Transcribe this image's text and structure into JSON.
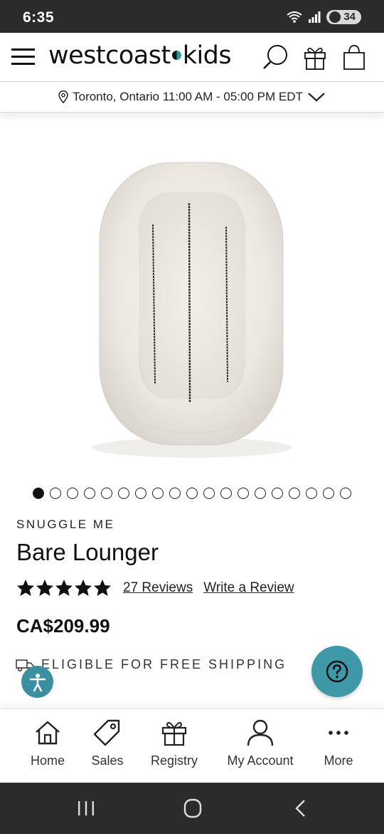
{
  "status_bar": {
    "time": "6:35",
    "battery": "34",
    "network": "6E"
  },
  "header": {
    "logo_left": "westcoast",
    "logo_right": "kids"
  },
  "location": {
    "text": "Toronto, Ontario 11:00 AM - 05:00 PM EDT"
  },
  "carousel": {
    "total": 19,
    "active_index": 0
  },
  "product": {
    "brand": "SNUGGLE ME",
    "title": "Bare Lounger",
    "rating": 5,
    "reviews_link": "27 Reviews",
    "write_review_link": "Write a Review",
    "price": "CA$209.99",
    "shipping": "ELIGIBLE FOR FREE SHIPPING"
  },
  "bottom_nav": {
    "home": "Home",
    "sales": "Sales",
    "registry": "Registry",
    "account": "My Account",
    "more": "More"
  },
  "colors": {
    "accent": "#3f98a7",
    "status_bar": "#2b2b2b"
  }
}
